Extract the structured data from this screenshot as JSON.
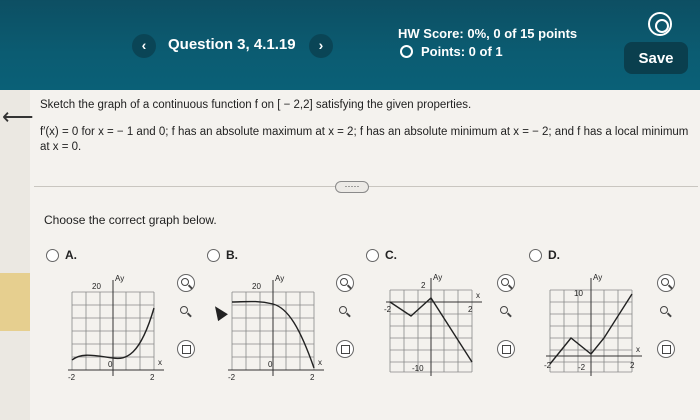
{
  "header": {
    "question_title": "Question 3, 4.1.19",
    "prev_glyph": "‹",
    "next_glyph": "›",
    "hw_score": "HW Score: 0%, 0 of 15 points",
    "points": "Points: 0 of 1",
    "save_label": "Save",
    "settings_icon": "gear-icon"
  },
  "question": {
    "prompt": "Sketch the graph of a continuous function f on [ − 2,2] satisfying the given properties.",
    "properties": "f′(x) = 0 for x = − 1 and 0; f has an absolute maximum at x = 2; f has an absolute minimum at x = − 2; and f has a local minimum at x = 0.",
    "more_label": "·····",
    "choose_label": "Choose the correct graph below."
  },
  "options": [
    {
      "label": "A.",
      "y_tick": "20",
      "x_min": "-2",
      "x_max": "2",
      "axis_x": "x",
      "axis_y": "Ay",
      "origin": "0"
    },
    {
      "label": "B.",
      "y_tick": "20",
      "x_min": "-2",
      "x_max": "2",
      "axis_x": "x",
      "axis_y": "Ay",
      "origin": "0"
    },
    {
      "label": "C.",
      "y_tick": "2",
      "y_tick_bottom": "-10",
      "x_min": "-2",
      "x_max": "2",
      "axis_x": "x",
      "axis_y": "Ay"
    },
    {
      "label": "D.",
      "y_tick": "10",
      "y_tick_bottom": "-2",
      "x_min": "-2",
      "x_max": "2",
      "axis_x": "x",
      "axis_y": "Ay"
    }
  ],
  "colors": {
    "header_bg": "#0b5c72",
    "save_bg": "#0a3f4e",
    "highlight": "#e6cf8f"
  }
}
